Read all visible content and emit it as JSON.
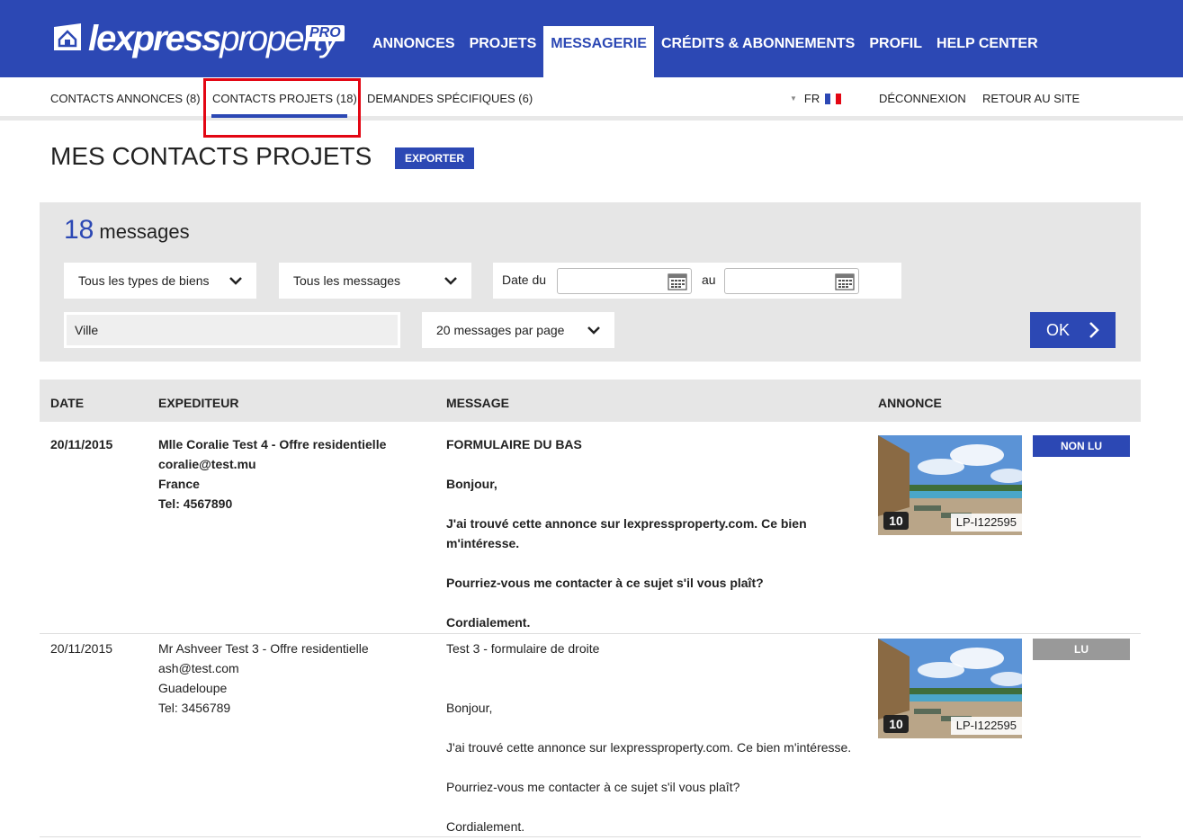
{
  "header": {
    "logo_text_bold": "lexpress",
    "logo_text_light": "property",
    "logo_badge": "PRO",
    "nav": [
      {
        "label": "ANNONCES",
        "active": false
      },
      {
        "label": "PROJETS",
        "active": false
      },
      {
        "label": "MESSAGERIE",
        "active": true
      },
      {
        "label": "CRÉDITS & ABONNEMENTS",
        "active": false
      },
      {
        "label": "PROFIL",
        "active": false
      },
      {
        "label": "HELP CENTER",
        "active": false
      }
    ],
    "brand_color": "#2c48b4"
  },
  "subnav": {
    "tabs": [
      {
        "label": "CONTACTS ANNONCES (8)",
        "active": false
      },
      {
        "label": "CONTACTS PROJETS (18)",
        "active": true
      },
      {
        "label": "DEMANDES SPÉCIFIQUES (6)",
        "active": false
      }
    ],
    "language": "FR",
    "logout": "DÉCONNEXION",
    "back_to_site": "RETOUR AU SITE"
  },
  "page": {
    "title": "MES CONTACTS PROJETS",
    "export_label": "EXPORTER"
  },
  "filters": {
    "count": "18",
    "count_label": "messages",
    "property_type": "Tous les types de biens",
    "message_type": "Tous les messages",
    "date_from_label": "Date du",
    "date_to_label": "au",
    "date_from_value": "",
    "date_to_value": "",
    "city_placeholder": "Ville",
    "per_page": "20 messages par page",
    "ok_label": "OK"
  },
  "table": {
    "headers": {
      "date": "DATE",
      "sender": "EXPEDITEUR",
      "message": "MESSAGE",
      "listing": "ANNONCE"
    },
    "rows": [
      {
        "date": "20/11/2015",
        "sender_name": "Mlle Coralie Test 4 - Offre residentielle",
        "sender_email": "coralie@test.mu",
        "sender_country": "France",
        "sender_tel": "Tel: 4567890",
        "msg_subject": "FORMULAIRE DU BAS",
        "msg_greeting": "Bonjour,",
        "msg_line1": "J'ai trouvé cette annonce sur lexpressproperty.com. Ce bien",
        "msg_line2": "m'intéresse.",
        "msg_question": "Pourriez-vous me contacter à ce sujet s'il vous plaît?",
        "msg_closing": "Cordialement.",
        "photo_count": "10",
        "listing_ref": "LP-I122595",
        "status": "NON LU",
        "status_color": "#2c48b4",
        "unread": true
      },
      {
        "date": "20/11/2015",
        "sender_name": "Mr Ashveer Test 3 - Offre residentielle",
        "sender_email": "ash@test.com",
        "sender_country": "Guadeloupe",
        "sender_tel": "Tel: 3456789",
        "msg_subject": "Test 3 - formulaire de droite",
        "msg_greeting": "Bonjour,",
        "msg_line1": "J'ai trouvé cette annonce sur lexpressproperty.com. Ce bien m'intéresse.",
        "msg_question": "Pourriez-vous me contacter à ce sujet s'il vous plaît?",
        "msg_closing": "Cordialement.",
        "photo_count": "10",
        "listing_ref": "LP-I122595",
        "status": "LU",
        "status_color": "#999999",
        "unread": false
      }
    ]
  }
}
